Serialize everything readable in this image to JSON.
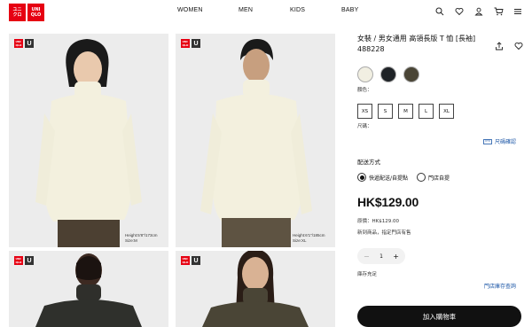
{
  "brand": {
    "logo_lines_left": [
      "ユニ",
      "クロ"
    ],
    "logo_lines_right": [
      "UNI",
      "QLO"
    ],
    "color": "#e60012"
  },
  "nav": [
    "WOMEN",
    "MEN",
    "KIDS",
    "BABY"
  ],
  "header_icons": [
    "search-icon",
    "heart-icon",
    "user-icon",
    "cart-icon",
    "menu-icon"
  ],
  "photos": [
    {
      "tag": "U",
      "size_note": [
        "Height:5'8\"/173cm",
        "Size:M"
      ]
    },
    {
      "tag": "U",
      "size_note": [
        "Height:6'1\"/185cm",
        "Size:XL"
      ]
    },
    {
      "tag": "U"
    },
    {
      "tag": "U"
    }
  ],
  "product": {
    "title": "女裝 / 男女通用 高領長版 T 恤 [長袖] 488228",
    "color_label": "顏色：",
    "colors": [
      "#f1efe2",
      "#1f2327",
      "#4a4536"
    ],
    "size_label": "尺碼：",
    "sizes": [
      "XS",
      "S",
      "M",
      "L",
      "XL"
    ],
    "size_check_link": "尺碼確認",
    "delivery_title": "配送方式",
    "delivery_options": [
      "快遞配送/自提點",
      "門店自提"
    ],
    "price": "HK$129.00",
    "original_price": "原價：HK$129.00",
    "new_note": "新到商品，指定門店有售",
    "quantity": "1",
    "stock": "庫存充足",
    "store_link": "門店庫存查詢",
    "add_to_cart": "加入購物車"
  }
}
